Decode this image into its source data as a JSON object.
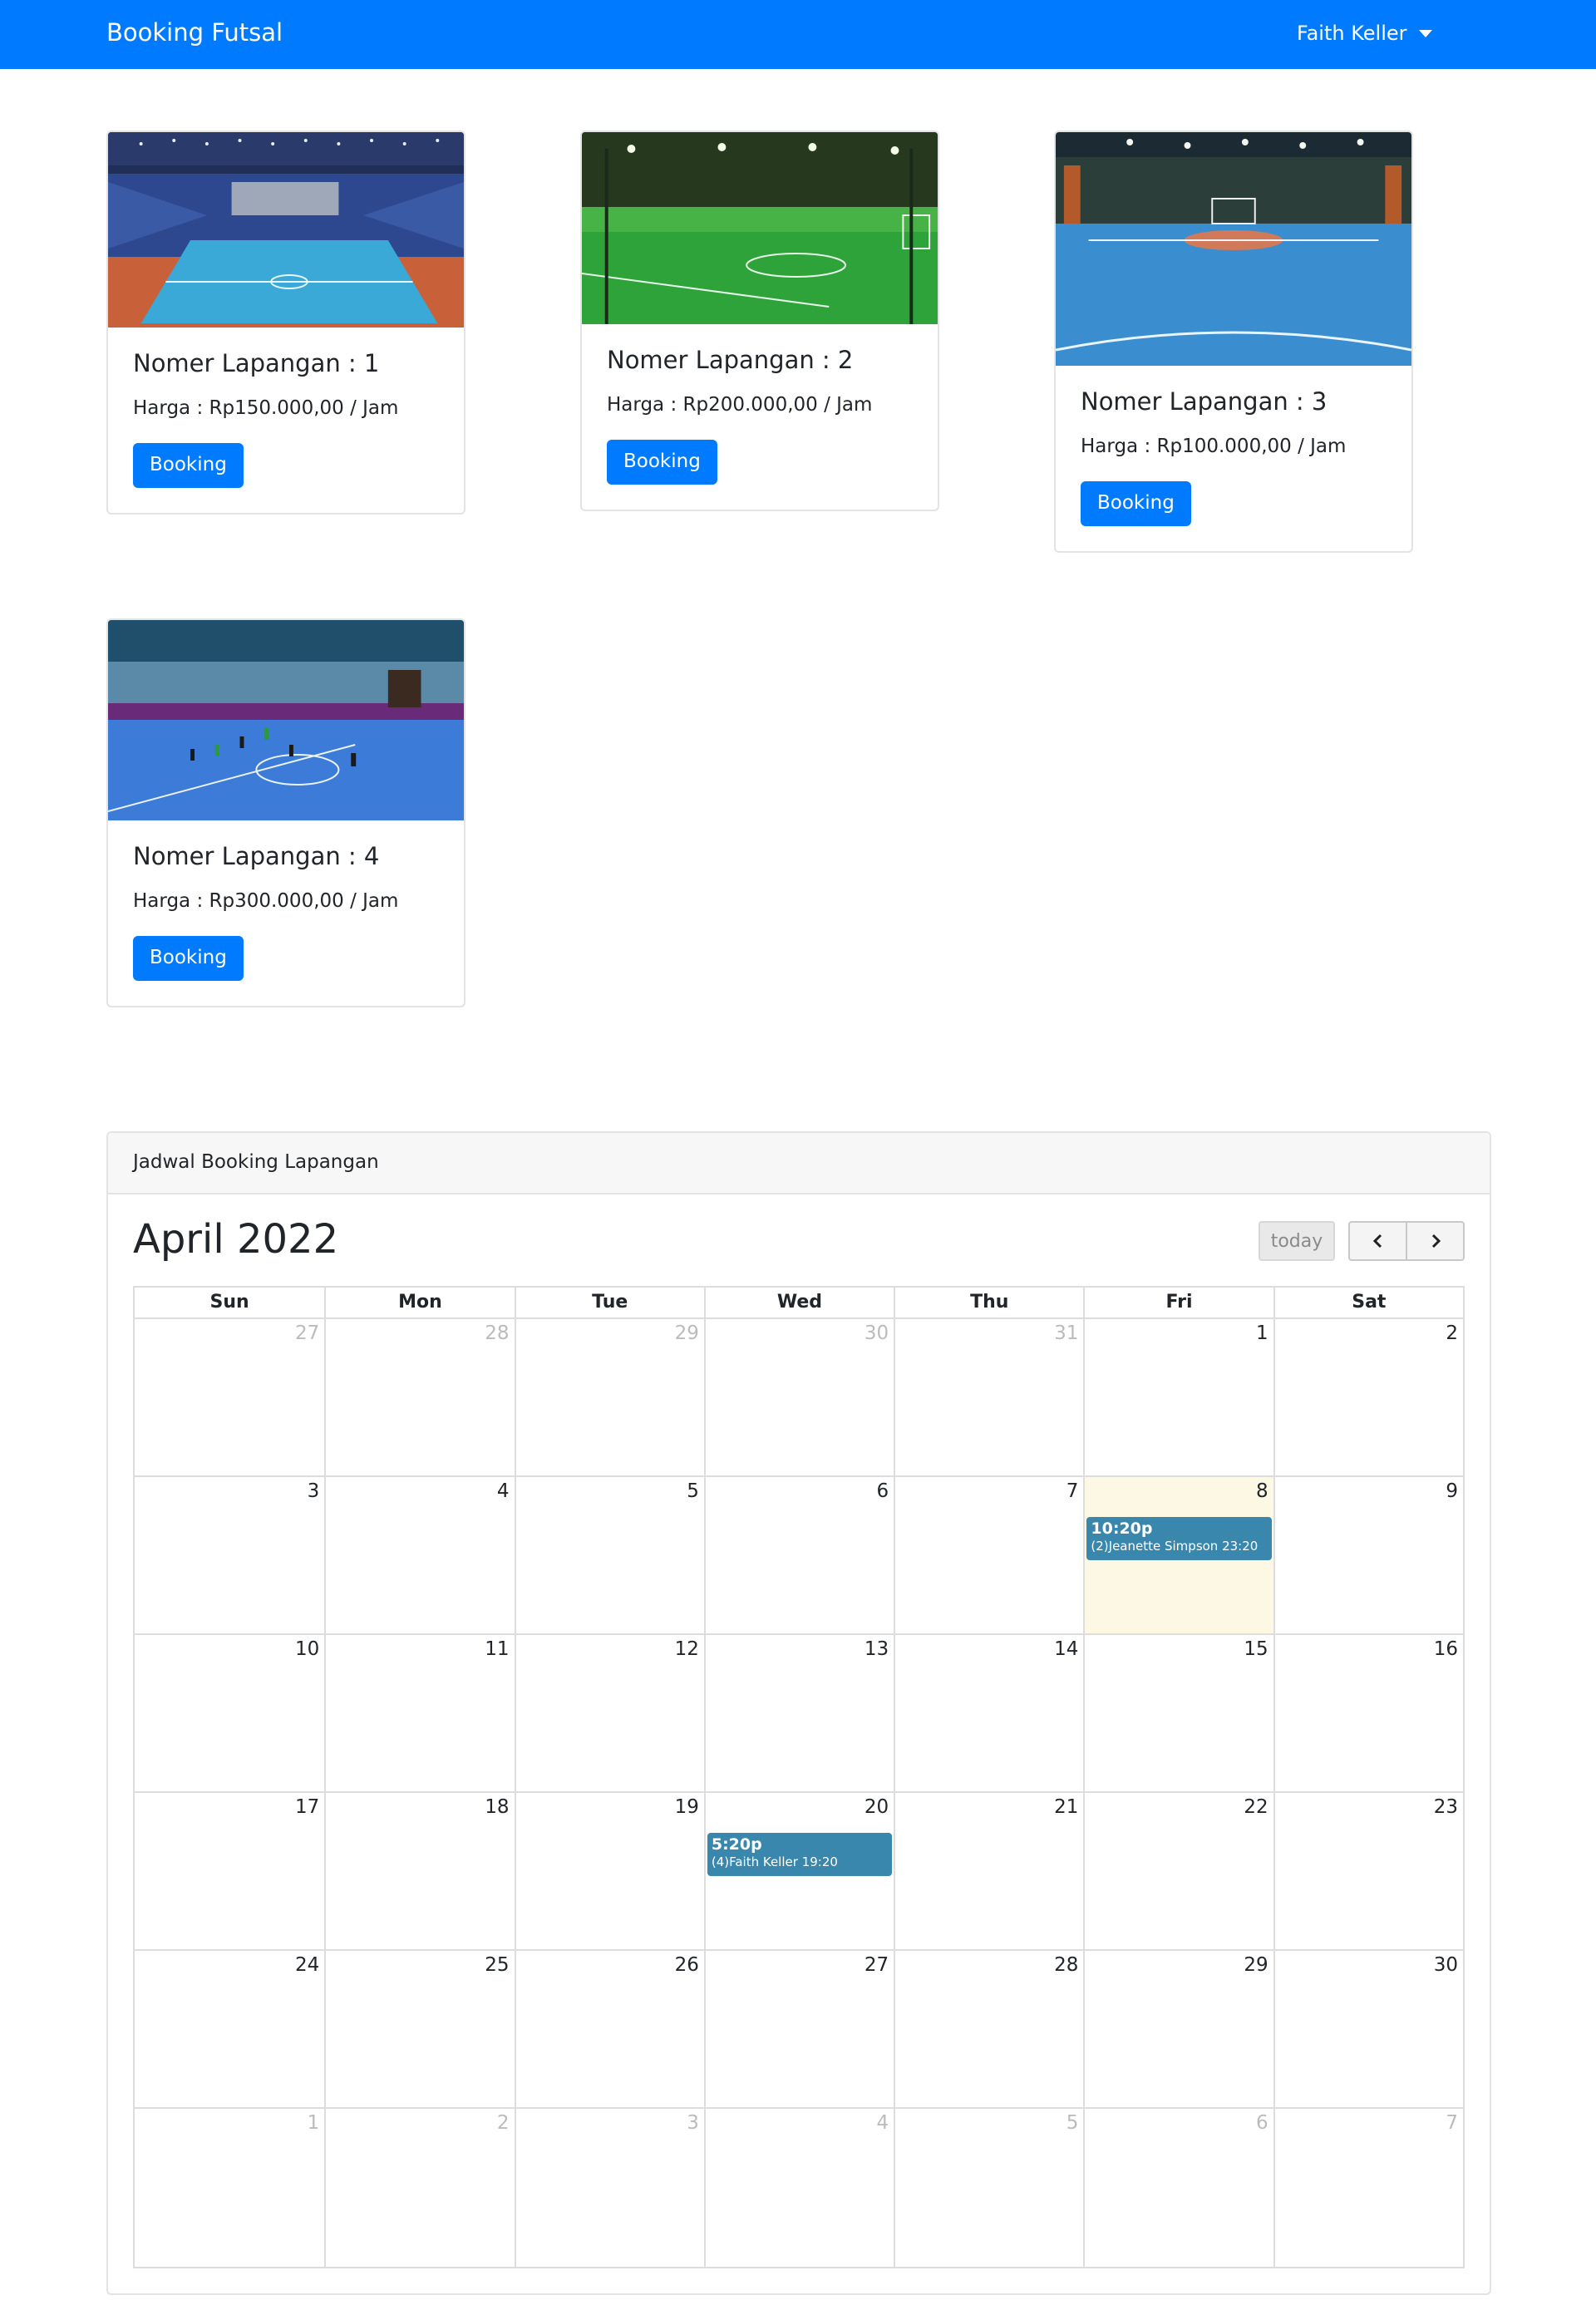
{
  "navbar": {
    "brand": "Booking Futsal",
    "user": "Faith Keller"
  },
  "courts": [
    {
      "title": "Nomer Lapangan : 1",
      "price": "Harga : Rp150.000,00 / Jam",
      "button": "Booking",
      "image": "indoor-arena-orange-blue-court"
    },
    {
      "title": "Nomer Lapangan : 2",
      "price": "Harga : Rp200.000,00 / Jam",
      "button": "Booking",
      "image": "green-turf-futsal-court"
    },
    {
      "title": "Nomer Lapangan : 3",
      "price": "Harga : Rp100.000,00 / Jam",
      "button": "Booking",
      "image": "blue-indoor-futsal-court"
    },
    {
      "title": "Nomer Lapangan : 4",
      "price": "Harga : Rp300.000,00 / Jam",
      "button": "Booking",
      "image": "blue-court-match-in-progress"
    }
  ],
  "calendar": {
    "panel_title": "Jadwal Booking Lapangan",
    "month_title": "April 2022",
    "today_label": "today",
    "day_names": [
      "Sun",
      "Mon",
      "Tue",
      "Wed",
      "Thu",
      "Fri",
      "Sat"
    ],
    "weeks": [
      [
        {
          "d": "27",
          "o": true
        },
        {
          "d": "28",
          "o": true
        },
        {
          "d": "29",
          "o": true
        },
        {
          "d": "30",
          "o": true
        },
        {
          "d": "31",
          "o": true
        },
        {
          "d": "1"
        },
        {
          "d": "2"
        }
      ],
      [
        {
          "d": "3"
        },
        {
          "d": "4"
        },
        {
          "d": "5"
        },
        {
          "d": "6"
        },
        {
          "d": "7"
        },
        {
          "d": "8",
          "today": true,
          "event": {
            "time": "10:20p",
            "title": "(2)Jeanette Simpson 23:20"
          }
        },
        {
          "d": "9"
        }
      ],
      [
        {
          "d": "10"
        },
        {
          "d": "11"
        },
        {
          "d": "12"
        },
        {
          "d": "13"
        },
        {
          "d": "14"
        },
        {
          "d": "15"
        },
        {
          "d": "16"
        }
      ],
      [
        {
          "d": "17"
        },
        {
          "d": "18"
        },
        {
          "d": "19"
        },
        {
          "d": "20",
          "event": {
            "time": "5:20p",
            "title": "(4)Faith Keller 19:20"
          }
        },
        {
          "d": "21"
        },
        {
          "d": "22"
        },
        {
          "d": "23"
        }
      ],
      [
        {
          "d": "24"
        },
        {
          "d": "25"
        },
        {
          "d": "26"
        },
        {
          "d": "27"
        },
        {
          "d": "28"
        },
        {
          "d": "29"
        },
        {
          "d": "30"
        }
      ],
      [
        {
          "d": "1",
          "o": true
        },
        {
          "d": "2",
          "o": true
        },
        {
          "d": "3",
          "o": true
        },
        {
          "d": "4",
          "o": true
        },
        {
          "d": "5",
          "o": true
        },
        {
          "d": "6",
          "o": true
        },
        {
          "d": "7",
          "o": true
        }
      ]
    ],
    "event_color": "#3a87ad",
    "today_color": "#fcf8e3"
  },
  "colors": {
    "primary": "#007bff"
  }
}
